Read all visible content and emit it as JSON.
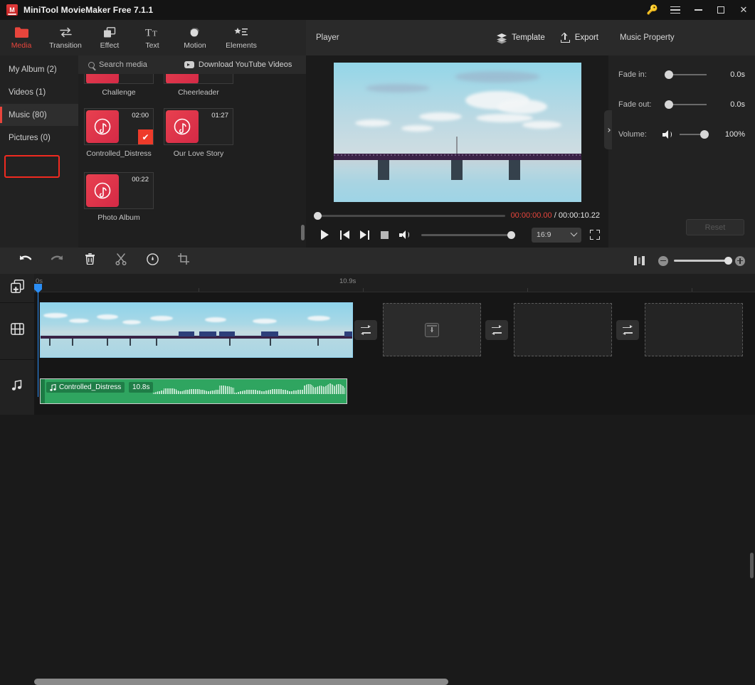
{
  "window": {
    "title": "MiniTool MovieMaker Free 7.1.1",
    "logo_letter": "M",
    "controls": {
      "key": "key-icon",
      "menu": "menu-icon",
      "minimize": "–",
      "maximize": "□",
      "close": "✕"
    }
  },
  "ribbon": {
    "items": [
      {
        "label": "Media",
        "icon": "folder-icon",
        "active": true
      },
      {
        "label": "Transition",
        "icon": "transition-icon",
        "active": false
      },
      {
        "label": "Effect",
        "icon": "effect-icon",
        "active": false
      },
      {
        "label": "Text",
        "icon": "text-icon",
        "active": false
      },
      {
        "label": "Motion",
        "icon": "motion-icon",
        "active": false
      },
      {
        "label": "Elements",
        "icon": "elements-icon",
        "active": false
      }
    ]
  },
  "sidebar": {
    "items": [
      {
        "label": "My Album (2)",
        "selected": false
      },
      {
        "label": "Videos (1)",
        "selected": false
      },
      {
        "label": "Music (80)",
        "selected": true
      },
      {
        "label": "Pictures (0)",
        "selected": false
      }
    ]
  },
  "media": {
    "search_placeholder": "Search media",
    "download_label": "Download YouTube Videos",
    "partial_row": [
      {
        "name": "Challenge"
      },
      {
        "name": "Cheerleader"
      }
    ],
    "items": [
      {
        "name": "Controlled_Distress",
        "duration": "02:00",
        "selected": true
      },
      {
        "name": "Our Love Story",
        "duration": "01:27",
        "selected": false
      },
      {
        "name": "Photo Album",
        "duration": "00:22",
        "selected": false
      }
    ]
  },
  "player": {
    "title": "Player",
    "template_label": "Template",
    "export_label": "Export",
    "current_time": "00:00:00.00",
    "separator": "/",
    "total_time": "00:00:10.22",
    "aspect_ratio": "16:9",
    "progress_percent": 0,
    "volume_percent": 100
  },
  "properties": {
    "title": "Music Property",
    "rows": [
      {
        "label": "Fade in:",
        "value": "0.0s",
        "slider_percent": 0
      },
      {
        "label": "Fade out:",
        "value": "0.0s",
        "slider_percent": 0
      },
      {
        "label": "Volume:",
        "value": "100%",
        "slider_percent": 100
      }
    ],
    "reset_label": "Reset"
  },
  "edit_toolbar": {
    "buttons": [
      {
        "name": "undo",
        "icon": "undo-icon"
      },
      {
        "name": "redo",
        "icon": "redo-icon"
      },
      {
        "name": "delete",
        "icon": "trash-icon"
      },
      {
        "name": "split",
        "icon": "scissors-icon"
      },
      {
        "name": "speed",
        "icon": "speed-icon"
      },
      {
        "name": "crop",
        "icon": "crop-icon"
      }
    ],
    "zoom_percent": 100
  },
  "timeline": {
    "ruler_labels": [
      "0s",
      "10.9s"
    ],
    "playhead_time": "0s",
    "video_clip": {
      "name": "video-clip"
    },
    "audio_clip": {
      "name": "Controlled_Distress",
      "duration": "10.8s"
    },
    "track_icons": [
      "add-media-icon",
      "video-track-icon",
      "audio-track-icon"
    ]
  },
  "colors": {
    "accent_red": "#e8453c",
    "selection_blue": "#2b8ef5",
    "audio_green": "#2fa560",
    "highlight_box": "#f02a20"
  }
}
